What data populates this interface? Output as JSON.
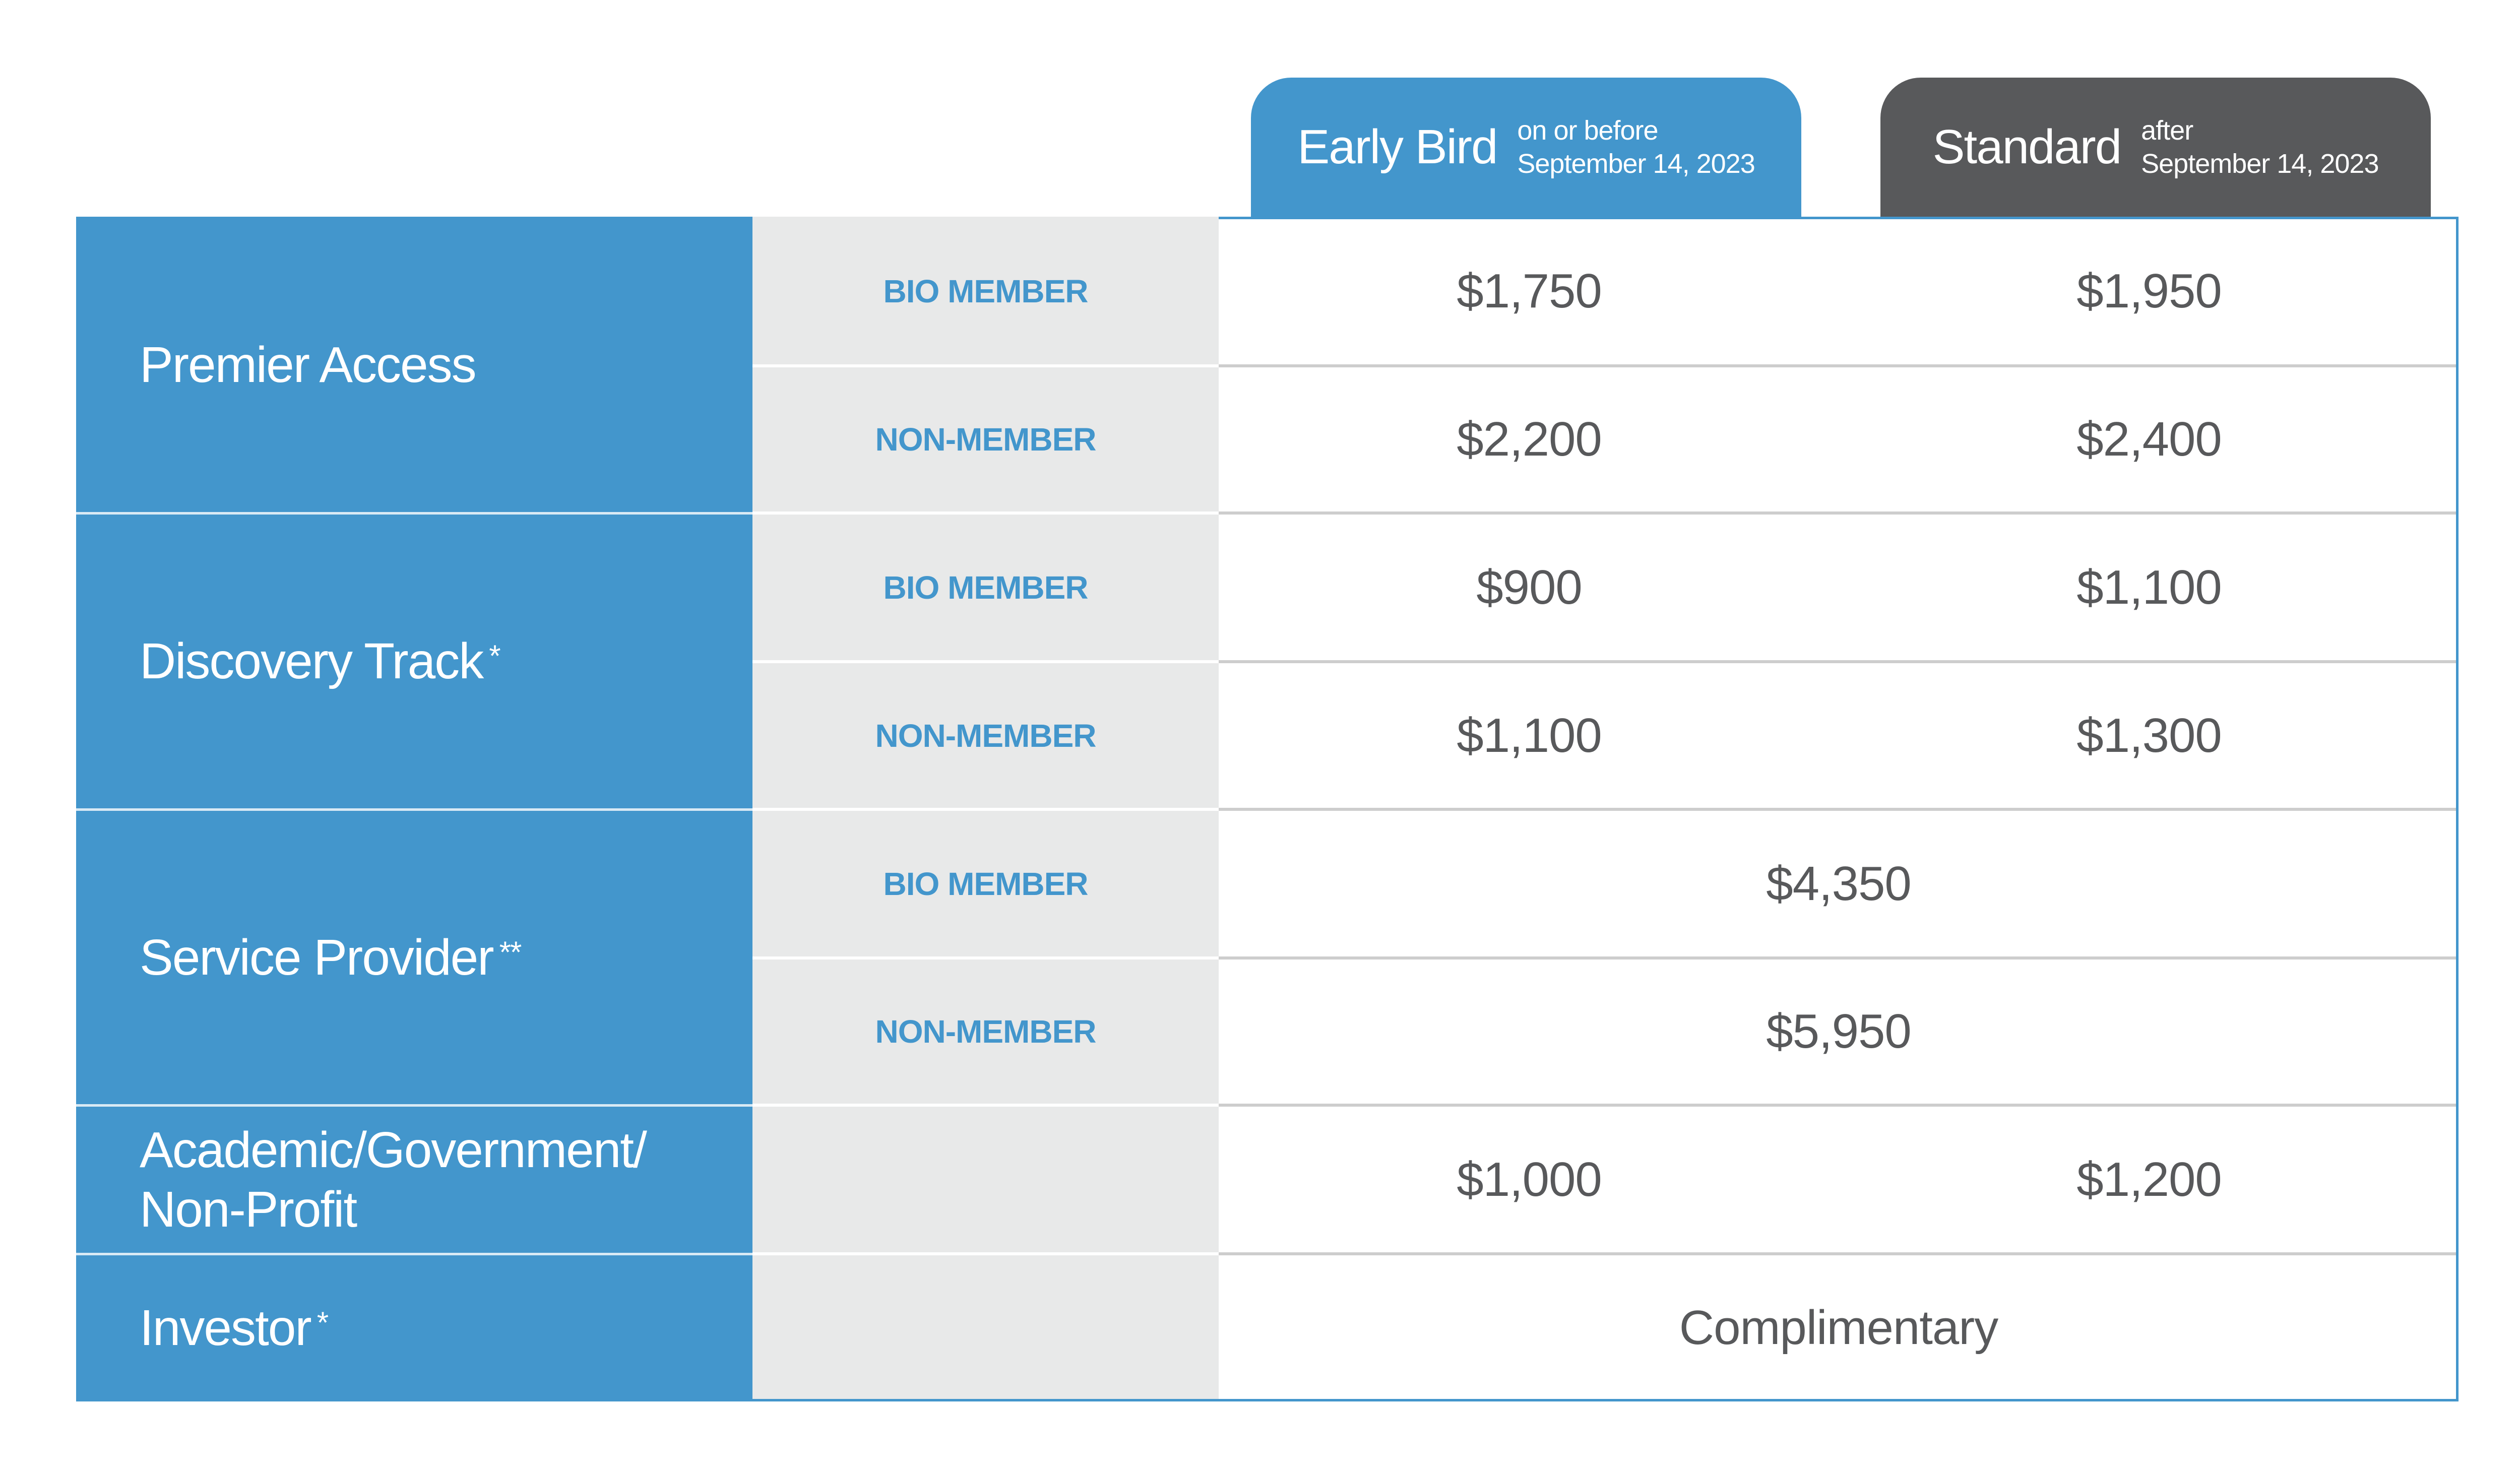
{
  "columns": {
    "early_bird": {
      "title": "Early Bird",
      "subtitle_line1": "on or before",
      "subtitle_line2": "September 14, 2023",
      "color": "#4396cc"
    },
    "standard": {
      "title": "Standard",
      "subtitle_line1": "after",
      "subtitle_line2": "September 14, 2023",
      "color": "#58595b"
    }
  },
  "categories": [
    {
      "name": "Premier Access",
      "mark": "",
      "rows": [
        {
          "member": "BIO MEMBER",
          "early_bird": "$1,750",
          "standard": "$1,950"
        },
        {
          "member": "NON-MEMBER",
          "early_bird": "$2,200",
          "standard": "$2,400"
        }
      ]
    },
    {
      "name": "Discovery Track",
      "mark": "*",
      "rows": [
        {
          "member": "BIO MEMBER",
          "early_bird": "$900",
          "standard": "$1,100"
        },
        {
          "member": "NON-MEMBER",
          "early_bird": "$1,100",
          "standard": "$1,300"
        }
      ]
    },
    {
      "name": "Service Provider",
      "mark": "**",
      "rows": [
        {
          "member": "BIO MEMBER",
          "price": "$4,350"
        },
        {
          "member": "NON-MEMBER",
          "price": "$5,950"
        }
      ]
    },
    {
      "name_line1": "Academic/Government/",
      "name_line2": "Non-Profit",
      "rows": [
        {
          "member": "",
          "early_bird": "$1,000",
          "standard": "$1,200"
        }
      ]
    },
    {
      "name": "Investor",
      "mark": "*",
      "rows": [
        {
          "member": "",
          "price": "Complimentary"
        }
      ]
    }
  ],
  "colors": {
    "primary_blue": "#4396cc",
    "dark_gray": "#58595b",
    "light_gray": "#e8e9e9"
  }
}
